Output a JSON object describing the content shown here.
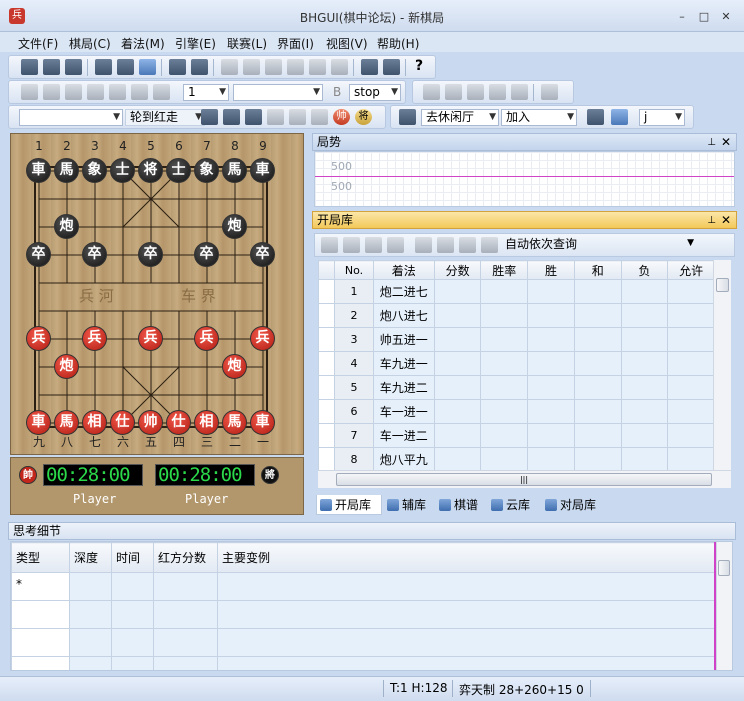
{
  "window": {
    "title": "BHGUI(棋中论坛) - 新棋局",
    "app_icon": "兵",
    "min": "–",
    "max": "□",
    "close": "✕"
  },
  "menu": [
    "文件(F)",
    "棋局(C)",
    "着法(M)",
    "引擎(E)",
    "联赛(L)",
    "界面(I)",
    "视图(V)",
    "帮助(H)"
  ],
  "toolbar": {
    "help": "?",
    "count_value": "1",
    "stop_label": "stop",
    "b_label": "B",
    "turn_label": "轮到红走",
    "room_label": "去休闲厅",
    "join_label": "加入",
    "j_value": "j",
    "red_badge": "帅",
    "black_badge": "将"
  },
  "board": {
    "top_files": [
      "1",
      "2",
      "3",
      "4",
      "5",
      "6",
      "7",
      "8",
      "9"
    ],
    "bottom_files": [
      "九",
      "八",
      "七",
      "六",
      "五",
      "四",
      "三",
      "二",
      "一"
    ],
    "river_left": "兵 河",
    "river_right": "车 界",
    "pieces": [
      {
        "c": "車",
        "s": "black",
        "f": 0,
        "r": 0
      },
      {
        "c": "馬",
        "s": "black",
        "f": 1,
        "r": 0
      },
      {
        "c": "象",
        "s": "black",
        "f": 2,
        "r": 0
      },
      {
        "c": "士",
        "s": "black",
        "f": 3,
        "r": 0
      },
      {
        "c": "将",
        "s": "black",
        "f": 4,
        "r": 0
      },
      {
        "c": "士",
        "s": "black",
        "f": 5,
        "r": 0
      },
      {
        "c": "象",
        "s": "black",
        "f": 6,
        "r": 0
      },
      {
        "c": "馬",
        "s": "black",
        "f": 7,
        "r": 0
      },
      {
        "c": "車",
        "s": "black",
        "f": 8,
        "r": 0
      },
      {
        "c": "炮",
        "s": "black",
        "f": 1,
        "r": 2
      },
      {
        "c": "炮",
        "s": "black",
        "f": 7,
        "r": 2
      },
      {
        "c": "卒",
        "s": "black",
        "f": 0,
        "r": 3
      },
      {
        "c": "卒",
        "s": "black",
        "f": 2,
        "r": 3
      },
      {
        "c": "卒",
        "s": "black",
        "f": 4,
        "r": 3
      },
      {
        "c": "卒",
        "s": "black",
        "f": 6,
        "r": 3
      },
      {
        "c": "卒",
        "s": "black",
        "f": 8,
        "r": 3
      },
      {
        "c": "兵",
        "s": "red",
        "f": 0,
        "r": 6
      },
      {
        "c": "兵",
        "s": "red",
        "f": 2,
        "r": 6
      },
      {
        "c": "兵",
        "s": "red",
        "f": 4,
        "r": 6
      },
      {
        "c": "兵",
        "s": "red",
        "f": 6,
        "r": 6
      },
      {
        "c": "兵",
        "s": "red",
        "f": 8,
        "r": 6
      },
      {
        "c": "炮",
        "s": "red",
        "f": 1,
        "r": 7
      },
      {
        "c": "炮",
        "s": "red",
        "f": 7,
        "r": 7
      },
      {
        "c": "車",
        "s": "red",
        "f": 0,
        "r": 9
      },
      {
        "c": "馬",
        "s": "red",
        "f": 1,
        "r": 9
      },
      {
        "c": "相",
        "s": "red",
        "f": 2,
        "r": 9
      },
      {
        "c": "仕",
        "s": "red",
        "f": 3,
        "r": 9
      },
      {
        "c": "帅",
        "s": "red",
        "f": 4,
        "r": 9
      },
      {
        "c": "仕",
        "s": "red",
        "f": 5,
        "r": 9
      },
      {
        "c": "相",
        "s": "red",
        "f": 6,
        "r": 9
      },
      {
        "c": "馬",
        "s": "red",
        "f": 7,
        "r": 9
      },
      {
        "c": "車",
        "s": "red",
        "f": 8,
        "r": 9
      }
    ]
  },
  "clocks": {
    "red_badge": "帥",
    "black_badge": "將",
    "red_time": "00:28:00",
    "black_time": "00:28:00",
    "red_player": "Player",
    "black_player": "Player"
  },
  "trend": {
    "title": "局势",
    "upper": "500",
    "lower": "500"
  },
  "opening": {
    "title": "开局库",
    "query_mode": "自动依次查询",
    "columns": [
      "No.",
      "着法",
      "分数",
      "胜率",
      "胜",
      "和",
      "负",
      "允许"
    ],
    "rows": [
      {
        "no": "1",
        "move": "炮二进七"
      },
      {
        "no": "2",
        "move": "炮八进七"
      },
      {
        "no": "3",
        "move": "帅五进一"
      },
      {
        "no": "4",
        "move": "车九进一"
      },
      {
        "no": "5",
        "move": "车九进二"
      },
      {
        "no": "6",
        "move": "车一进一"
      },
      {
        "no": "7",
        "move": "车一进二"
      },
      {
        "no": "8",
        "move": "炮八平九"
      }
    ],
    "hscroll_grip": "|||"
  },
  "tabs": [
    "开局库",
    "辅库",
    "棋谱",
    "云库",
    "对局库"
  ],
  "think": {
    "title": "思考细节",
    "columns": [
      "类型",
      "深度",
      "时间",
      "红方分数",
      "主要变例"
    ],
    "first_row_marker": "*"
  },
  "status": {
    "th": "T:1 H:128",
    "rule": "弈天制 28+260+15 0"
  }
}
